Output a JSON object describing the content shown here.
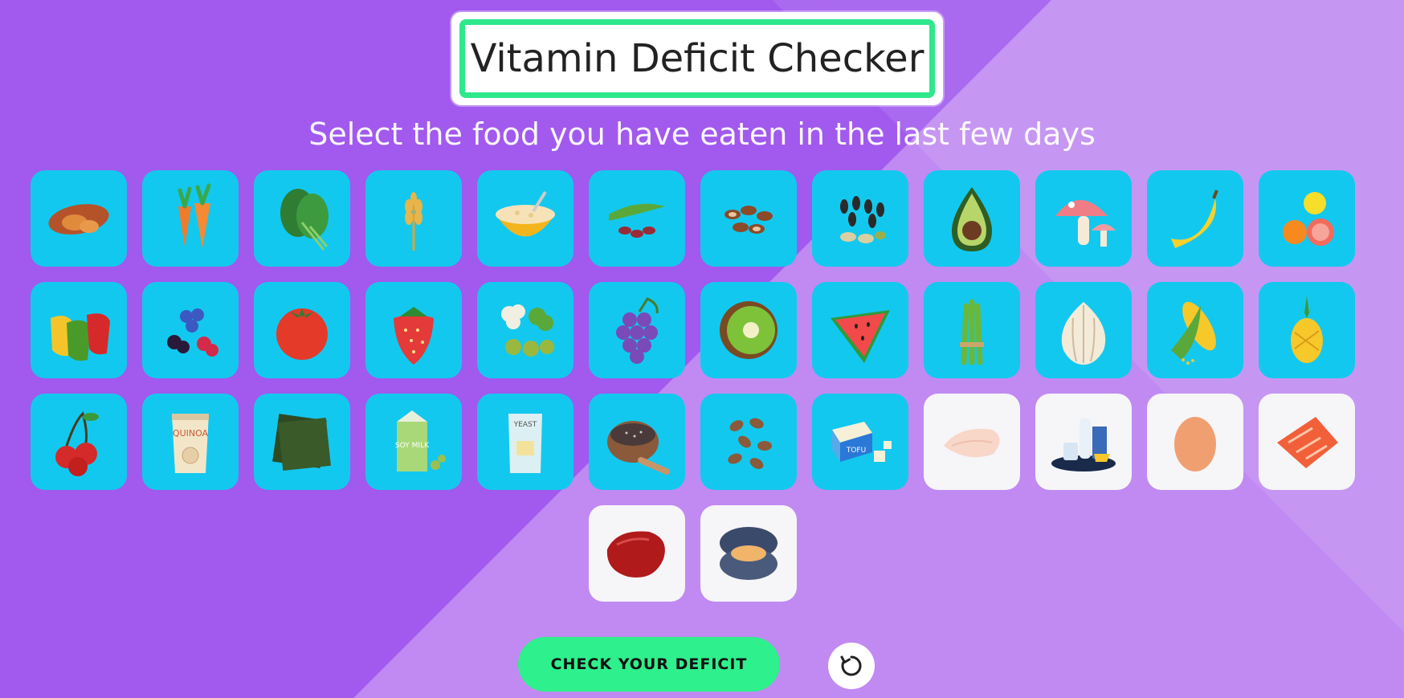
{
  "title": "Vitamin Deficit Checker",
  "subtitle": "Select the food you have eaten in the last few days",
  "colors": {
    "tile_blue": "#13c8ee",
    "tile_white": "#f6f5f8",
    "accent_green": "#2ef08c",
    "bg_purple": "#a159ee"
  },
  "foods": [
    {
      "id": "sweet-potato",
      "icon": "sweet-potato-icon"
    },
    {
      "id": "carrots",
      "icon": "carrots-icon"
    },
    {
      "id": "spinach",
      "icon": "spinach-icon"
    },
    {
      "id": "wheat",
      "icon": "wheat-icon"
    },
    {
      "id": "oatmeal",
      "icon": "oatmeal-bowl-icon"
    },
    {
      "id": "beans",
      "icon": "beans-icon"
    },
    {
      "id": "brazil-nuts",
      "icon": "nuts-icon"
    },
    {
      "id": "sunflower-seeds",
      "icon": "seeds-icon"
    },
    {
      "id": "avocado",
      "icon": "avocado-icon"
    },
    {
      "id": "mushroom",
      "icon": "mushroom-icon"
    },
    {
      "id": "banana",
      "icon": "banana-icon"
    },
    {
      "id": "citrus",
      "icon": "citrus-icon"
    },
    {
      "id": "bell-peppers",
      "icon": "bell-peppers-icon"
    },
    {
      "id": "berries",
      "icon": "berries-icon"
    },
    {
      "id": "tomato",
      "icon": "tomato-icon"
    },
    {
      "id": "strawberry",
      "icon": "strawberry-icon"
    },
    {
      "id": "cruciferous",
      "icon": "cauliflower-broccoli-icon"
    },
    {
      "id": "grapes",
      "icon": "grapes-icon"
    },
    {
      "id": "kiwi",
      "icon": "kiwi-icon"
    },
    {
      "id": "watermelon",
      "icon": "watermelon-icon"
    },
    {
      "id": "asparagus",
      "icon": "asparagus-icon"
    },
    {
      "id": "garlic",
      "icon": "garlic-icon"
    },
    {
      "id": "corn",
      "icon": "corn-icon"
    },
    {
      "id": "pineapple",
      "icon": "pineapple-icon"
    },
    {
      "id": "cherries",
      "icon": "cherries-icon"
    },
    {
      "id": "quinoa",
      "icon": "quinoa-bag-icon",
      "label": "QUINOA"
    },
    {
      "id": "seaweed",
      "icon": "seaweed-icon"
    },
    {
      "id": "soy-milk",
      "icon": "soy-milk-icon",
      "label": "SOY MILK"
    },
    {
      "id": "yeast",
      "icon": "yeast-bag-icon",
      "label": "YEAST"
    },
    {
      "id": "chia-seeds",
      "icon": "chia-bowl-icon"
    },
    {
      "id": "cocoa-beans",
      "icon": "cocoa-beans-icon"
    },
    {
      "id": "tofu",
      "icon": "tofu-icon",
      "label": "TOFU"
    },
    {
      "id": "chicken-breast",
      "icon": "chicken-breast-icon"
    },
    {
      "id": "dairy",
      "icon": "dairy-icon"
    },
    {
      "id": "egg",
      "icon": "egg-icon"
    },
    {
      "id": "salmon",
      "icon": "salmon-icon"
    },
    {
      "id": "liver",
      "icon": "liver-icon"
    },
    {
      "id": "mussel",
      "icon": "mussel-icon"
    }
  ],
  "buttons": {
    "check": "CHECK YOUR DEFICIT",
    "reset_icon": "reset-icon"
  }
}
